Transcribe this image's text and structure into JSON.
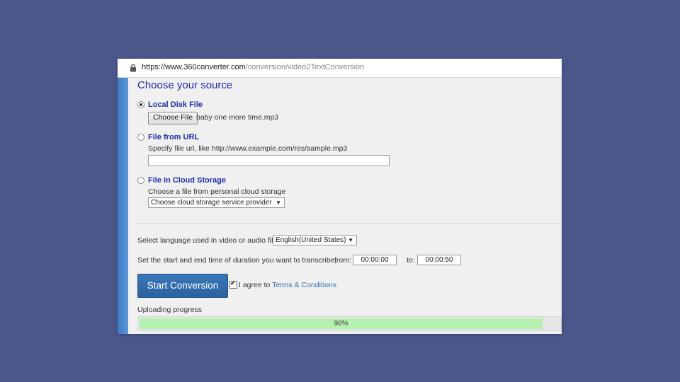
{
  "browser": {
    "url_host": "https://www.360converter.com",
    "url_path": "/conversion/video2TextConversion"
  },
  "section": {
    "title": "Choose your source"
  },
  "sources": {
    "local": {
      "label": "Local Disk File",
      "button": "Choose File",
      "filename": "baby one more time.mp3",
      "checked": true
    },
    "url": {
      "label": "File from URL",
      "hint": "Specify file url, like http://www.example.com/res/sample.mp3",
      "value": ""
    },
    "cloud": {
      "label": "File in Cloud Storage",
      "hint": "Choose a file from personal cloud storage",
      "select": "Choose cloud storage service provider"
    }
  },
  "language": {
    "label": "Select language used in video or audio file",
    "selected": "English(United States)"
  },
  "duration": {
    "label": "Set the start and end time of duration you want to transcribe,",
    "from_label": "from:",
    "from_value": "00:00:00",
    "to_label": "to:",
    "to_value": "00:00:50"
  },
  "actions": {
    "start": "Start Conversion",
    "agree_prefix": "I agree to ",
    "agree_link": "Terms & Conditions",
    "agree_checked": true
  },
  "progress": {
    "label": "Uploading progress",
    "value": 0.96,
    "text": "96%",
    "color": "#b5f1b1"
  }
}
